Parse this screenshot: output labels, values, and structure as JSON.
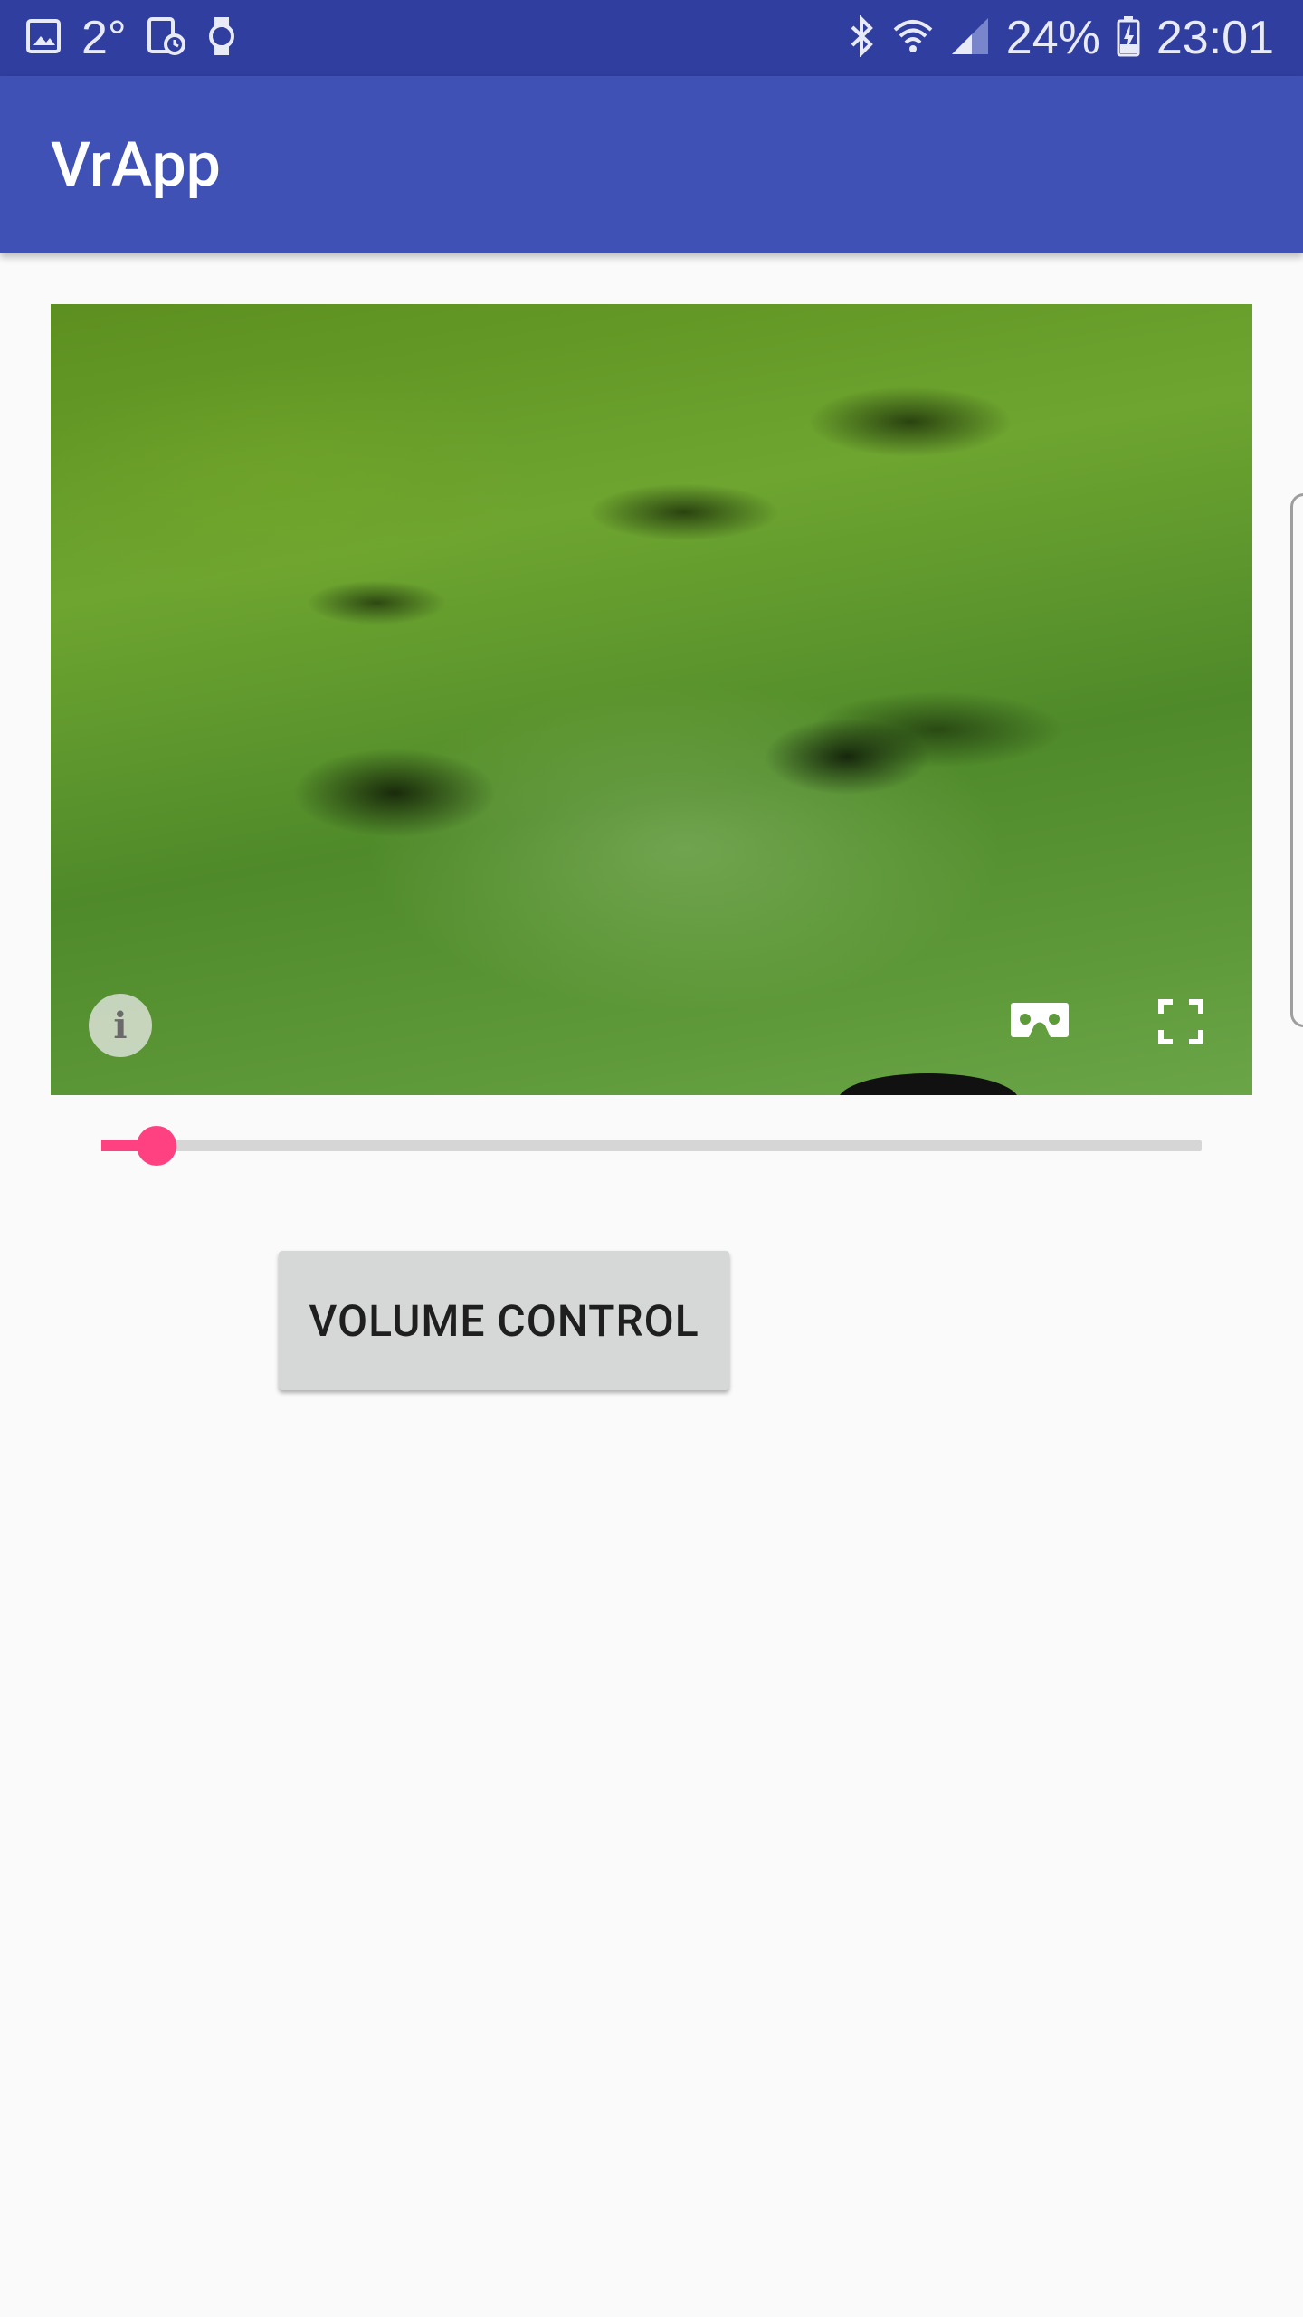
{
  "status_bar": {
    "temperature": "2°",
    "battery_percent": "24%",
    "time": "23:01",
    "icons_left": [
      "gallery-icon",
      "temperature",
      "screen-clock-icon",
      "watch-icon"
    ],
    "icons_right": [
      "bluetooth-icon",
      "wifi-icon",
      "cell-signal-icon",
      "battery-charging-icon"
    ]
  },
  "app_bar": {
    "title": "VrApp"
  },
  "vr_view": {
    "controls": [
      "info-icon",
      "cardboard-icon",
      "fullscreen-icon"
    ]
  },
  "seek_bar": {
    "progress_fraction": 0.05
  },
  "volume_button": {
    "label": "VOLUME CONTROL"
  },
  "colors": {
    "status_bar": "#303f9f",
    "app_bar": "#3f51b5",
    "accent": "#ff4081",
    "background": "#fafafa",
    "button": "#d6d7d7"
  }
}
